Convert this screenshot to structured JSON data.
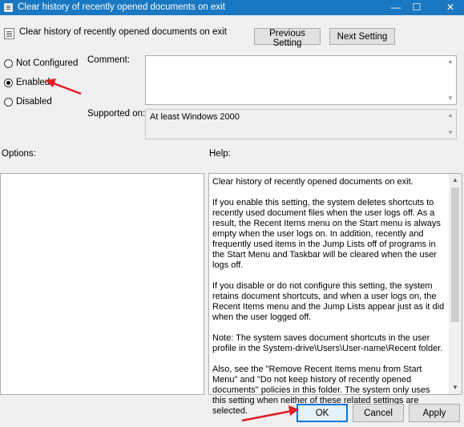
{
  "window": {
    "title": "Clear history of recently opened documents on exit",
    "controls": {
      "minimize": "—",
      "maximize": "☐",
      "close": "✕"
    }
  },
  "header": {
    "title": "Clear history of recently opened documents on exit",
    "prev_label": "Previous Setting",
    "next_label": "Next Setting"
  },
  "state": {
    "options": [
      {
        "label": "Not Configured",
        "selected": false
      },
      {
        "label": "Enabled",
        "selected": true
      },
      {
        "label": "Disabled",
        "selected": false
      }
    ]
  },
  "comment": {
    "label": "Comment:",
    "value": ""
  },
  "supported": {
    "label": "Supported on:",
    "value": "At least Windows 2000"
  },
  "options_panel": {
    "label": "Options:"
  },
  "help": {
    "label": "Help:",
    "paragraphs": [
      "Clear history of recently opened documents on exit.",
      "If you enable this setting, the system deletes shortcuts to recently used document files when the user logs off. As a result, the Recent Items menu on the Start menu is always empty when the user logs on. In addition, recently and frequently used items in the Jump Lists off of programs in the Start Menu and Taskbar will be cleared when the user logs off.",
      "If you disable or do not configure this setting, the system retains document shortcuts, and when a user logs on, the Recent Items menu and the Jump Lists appear just as it did when the user logged off.",
      "Note: The system saves document shortcuts in the user profile in the System-drive\\Users\\User-name\\Recent folder.",
      "Also, see the \"Remove Recent Items menu from Start Menu\" and \"Do not keep history of recently opened documents\" policies in this folder. The system only uses this setting when neither of these related settings are selected."
    ]
  },
  "footer": {
    "ok": "OK",
    "cancel": "Cancel",
    "apply": "Apply"
  },
  "colors": {
    "titlebar": "#1a78c2",
    "annotation_arrow": "#e31b23",
    "dialog_bg": "#f0f0f0"
  }
}
